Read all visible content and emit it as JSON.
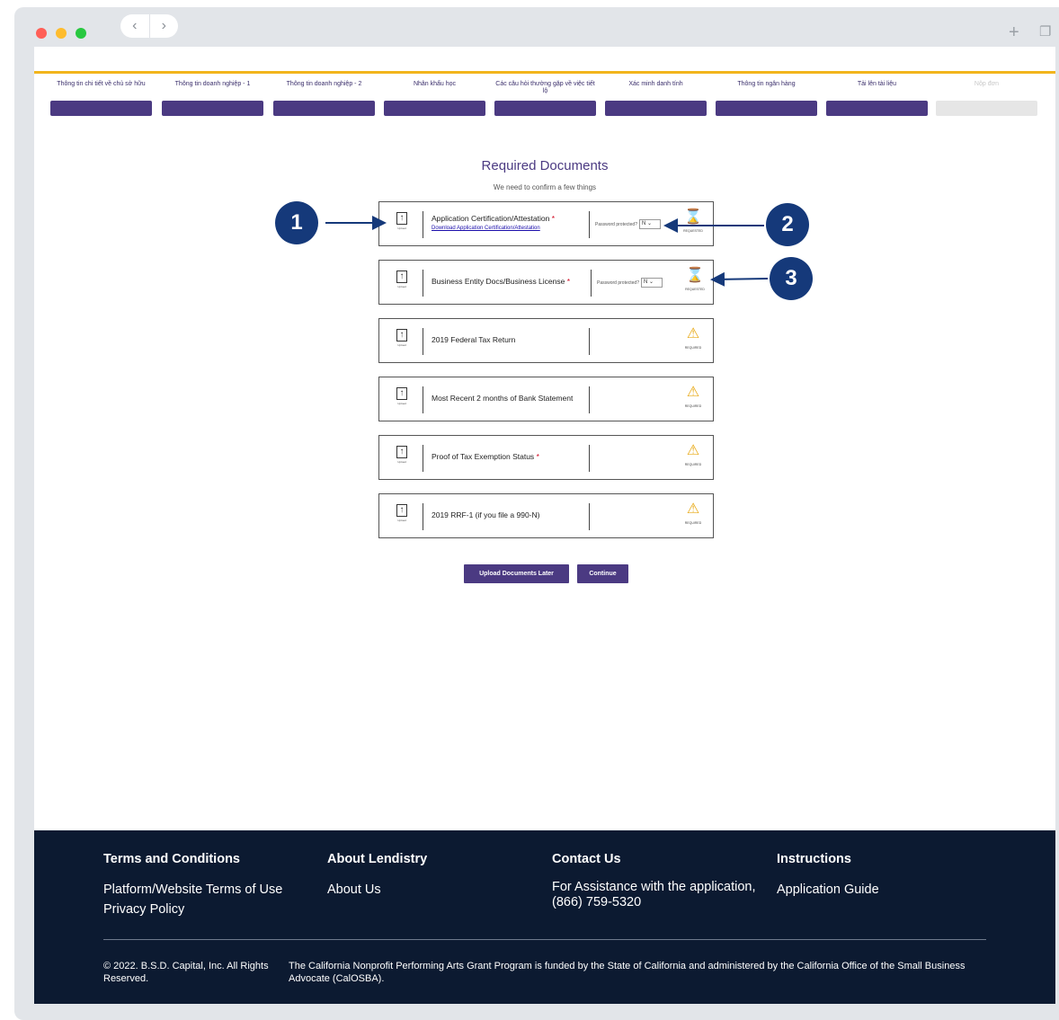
{
  "steps": [
    {
      "label": "Thông tin chi tiết về chủ sở hữu",
      "state": "complete"
    },
    {
      "label": "Thông tin doanh nghiệp - 1",
      "state": "complete"
    },
    {
      "label": "Thông tin doanh nghiệp - 2",
      "state": "complete"
    },
    {
      "label": "Nhân khẩu học",
      "state": "complete"
    },
    {
      "label": "Các câu hỏi thường gặp về việc tiết lộ",
      "state": "complete"
    },
    {
      "label": "Xác minh danh tính",
      "state": "complete"
    },
    {
      "label": "Thông tin ngân hàng",
      "state": "complete"
    },
    {
      "label": "Tải lên tài liệu",
      "state": "complete"
    },
    {
      "label": "Nộp đơn",
      "state": "disabled"
    }
  ],
  "required": {
    "title": "Required Documents",
    "subtitle": "We need to confirm a few things"
  },
  "upload_label": "Upload",
  "documents": [
    {
      "name": "Application Certification/Attestation",
      "required_mark": "*",
      "link": "Download Application Certification/Attestation",
      "password_label": "Password protected?",
      "password_value": "N",
      "status": "REQUESTED",
      "status_icon": "hourglass"
    },
    {
      "name": "Business Entity Docs/Business License",
      "required_mark": "*",
      "password_label": "Password protected?",
      "password_value": "N",
      "status": "REQUESTED",
      "status_icon": "hourglass"
    },
    {
      "name": "2019 Federal Tax Return",
      "required_mark": "",
      "status": "REQUIRED",
      "status_icon": "warning"
    },
    {
      "name": "Most Recent 2 months of Bank Statement",
      "required_mark": "",
      "status": "REQUIRED",
      "status_icon": "warning"
    },
    {
      "name": "Proof of Tax Exemption Status",
      "required_mark": "*",
      "status": "REQUIRED",
      "status_icon": "warning"
    },
    {
      "name": "2019 RRF-1 (if you file a 990-N)",
      "required_mark": "",
      "status": "REQUIRED",
      "status_icon": "warning"
    }
  ],
  "buttons": {
    "later": "Upload Documents Later",
    "continue": "Continue"
  },
  "callouts": [
    "1",
    "2",
    "3"
  ],
  "footer": {
    "terms_head": "Terms and Conditions",
    "terms_link1": "Platform/Website Terms of Use",
    "terms_link2": "Privacy Policy",
    "about_head": "About Lendistry",
    "about_link": "About Us",
    "contact_head": "Contact Us",
    "contact_text": "For Assistance with the application,",
    "contact_phone": "(866) 759-5320",
    "instr_head": "Instructions",
    "instr_link": "Application Guide",
    "copyright": "© 2022. B.S.D. Capital, Inc. All Rights Reserved.",
    "funding": "The California Nonprofit Performing Arts Grant Program is funded by the State of California and administered by the California Office of the Small Business Advocate (CalOSBA)."
  },
  "colors": {
    "brand": "#4b3a82",
    "accent": "#f2b51c",
    "footer": "#0c1a31",
    "callout": "#15397a"
  }
}
